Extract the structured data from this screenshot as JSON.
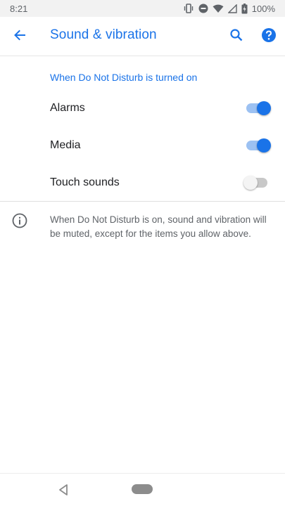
{
  "status_bar": {
    "time": "8:21",
    "battery": "100%",
    "icons": [
      "vibrate-icon",
      "do-not-disturb-icon",
      "wifi-icon",
      "cell-signal-icon",
      "battery-charging-icon"
    ]
  },
  "app_bar": {
    "title": "Sound & vibration",
    "icons": [
      "back-arrow-icon",
      "search-icon",
      "help-icon"
    ]
  },
  "section": {
    "header": "When Do Not Disturb is turned on"
  },
  "settings": [
    {
      "label": "Alarms",
      "enabled": true
    },
    {
      "label": "Media",
      "enabled": true
    },
    {
      "label": "Touch sounds",
      "enabled": false
    }
  ],
  "info": {
    "text": "When Do Not Disturb is on, sound and vibration will be muted, except for the items you allow above.",
    "icon": "info-icon"
  },
  "nav_bar": {
    "icons": [
      "nav-back-icon",
      "nav-home-pill"
    ]
  },
  "colors": {
    "accent": "#1a73e8",
    "accent_track": "#9cc1f2",
    "off_track": "#c8c8c8",
    "secondary_text": "#5f6368"
  }
}
